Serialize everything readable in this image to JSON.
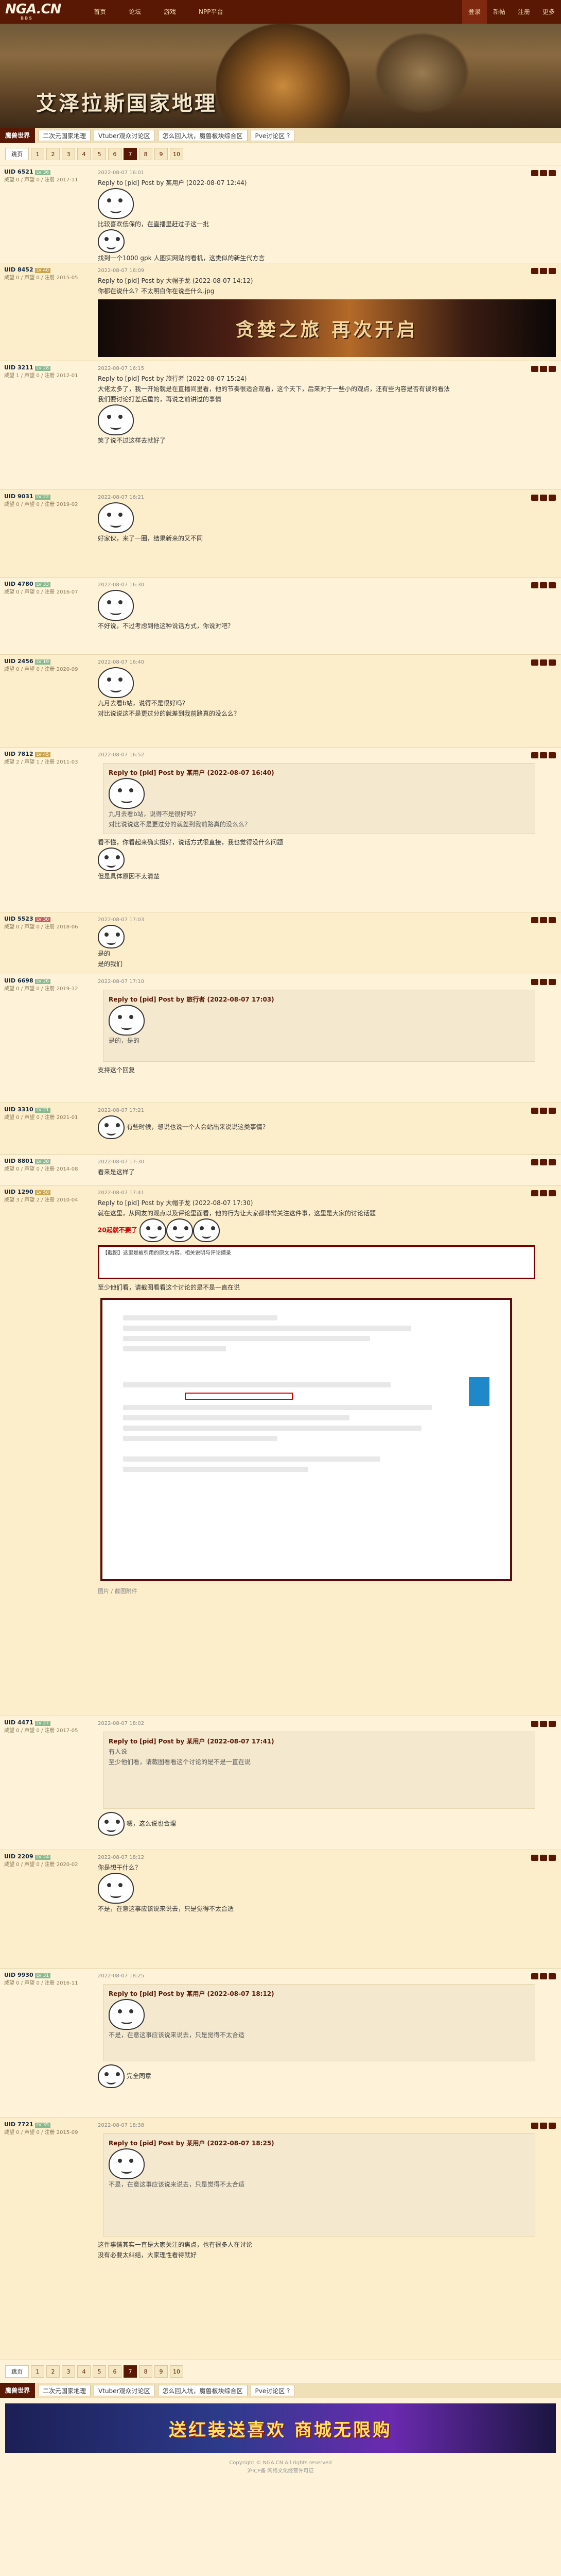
{
  "topnav": {
    "logo_big": "NGA.CN",
    "logo_small": "BBS",
    "items": [
      "首页",
      "论坛",
      "游戏",
      "NPP平台"
    ],
    "right": [
      "登录",
      "新帖",
      "注册",
      "更多"
    ]
  },
  "banner": {
    "title": "艾泽拉斯国家地理"
  },
  "forum_tabs": {
    "fid": "魔兽世界",
    "links": [
      "二次元国家地理",
      "Vtuber观众讨论区",
      "怎么回入坑，魔兽板块综合区",
      "Pve讨论区 ?"
    ]
  },
  "pager": {
    "label": "跳页",
    "pages": [
      "1",
      "2",
      "3",
      "4",
      "5",
      "6",
      "7",
      "8",
      "9",
      "10"
    ],
    "current": "7"
  },
  "posts": [
    {
      "user": "UID 6521",
      "lv": "LV 36",
      "meta": "威望 0 / 声望 0 / 注册 2017-11",
      "time": "2022-08-07 16:01",
      "quote": "Reply to [pid] Post by 某用户 (2022-08-07 12:44)",
      "text": "比较喜欢低保的，在直播里赶过子这一批",
      "text2": "找到一个1000 gpk 人图实网贴的看机，这类似的新生代方言"
    },
    {
      "user": "UID 8452",
      "lv": "LV 40",
      "meta": "威望 0 / 声望 0 / 注册 2015-05",
      "time": "2022-08-07 16:09",
      "quote": "Reply to [pid] Post by 大帽子龙 (2022-08-07 14:12)",
      "text": "你都在说什么？不太明白你在说些什么.jpg",
      "game_banner": "贪婪之旅 再次开启"
    },
    {
      "user": "UID 3211",
      "lv": "LV 28",
      "meta": "威望 1 / 声望 0 / 注册 2012-01",
      "time": "2022-08-07 16:15",
      "quote": "Reply to [pid] Post by 旅行者 (2022-08-07 15:24)",
      "text": "大佬太多了，我一开始就是在直播间里看，他的节奏很适合观看，这个天下，后来对于一些小的观点，还有些内容是否有误的看法",
      "text2": "我们要讨论打差后重的，再说之前讲过的事情",
      "text3": "笑了说不过这样去就好了"
    },
    {
      "user": "UID 9031",
      "lv": "LV 22",
      "meta": "威望 0 / 声望 0 / 注册 2019-02",
      "time": "2022-08-07 16:21",
      "text": "好家伙，来了一圈，结果新来的又不同"
    },
    {
      "user": "UID 4780",
      "lv": "LV 33",
      "meta": "威望 0 / 声望 0 / 注册 2016-07",
      "time": "2022-08-07 16:30",
      "text": "不好说，不过考虑到他这种说话方式，你说对吧？"
    },
    {
      "user": "UID 2456",
      "lv": "LV 19",
      "meta": "威望 0 / 声望 0 / 注册 2020-09",
      "time": "2022-08-07 16:40",
      "text": "九月去看b站，说得不是很好吗？",
      "text2": "对比说说这不是更过分的就差到我前路真的没么么？"
    },
    {
      "user": "UID 7812",
      "lv": "LV 45",
      "meta": "威望 2 / 声望 1 / 注册 2011-03",
      "time": "2022-08-07 16:52",
      "quote": "Reply to [pid] Post by 某用户 (2022-08-07 16:40)",
      "qtext": "九月去看b站，说得不是很好吗？",
      "qtext2": "对比说说这不是更过分的就差到我前路真的没么么？",
      "text": "看不懂，你看起来确实挺好，说话方式很直接，我也觉得没什么问题",
      "text2": "但是具体原因不太清楚"
    },
    {
      "user": "UID 5523",
      "lv": "LV 30",
      "meta": "威望 0 / 声望 0 / 注册 2018-06",
      "time": "2022-08-07 17:03",
      "text": "是的",
      "text2": "是的我们"
    },
    {
      "user": "UID 6698",
      "lv": "LV 26",
      "meta": "威望 0 / 声望 0 / 注册 2019-12",
      "time": "2022-08-07 17:10",
      "quote": "Reply to [pid] Post by 旅行者 (2022-08-07 17:03)",
      "qtext": "是的，是的",
      "text": "支持这个回复"
    },
    {
      "user": "UID 3310",
      "lv": "LV 21",
      "meta": "威望 0 / 声望 0 / 注册 2021-01",
      "time": "2022-08-07 17:21",
      "text": "有些时候，想说也说一个人会站出来说说这类事情？"
    },
    {
      "user": "UID 8801",
      "lv": "LV 38",
      "meta": "威望 0 / 声望 0 / 注册 2014-08",
      "time": "2022-08-07 17:30",
      "text": "看来是这样了"
    },
    {
      "user": "UID 1290",
      "lv": "LV 50",
      "meta": "威望 3 / 声望 2 / 注册 2010-04",
      "time": "2022-08-07 17:41",
      "quote": "Reply to [pid] Post by 大帽子龙 (2022-08-07 17:30)",
      "text": "就在这里，从网友的观点以及评论里面看，他的行为让大家都非常关注这件事，这里是大家的讨论话题",
      "red": "20起就不要了",
      "box": "【截图】这里是被引用的原文内容，相关说明与评论摘录",
      "text2": "至少他们看，请截图看看这个讨论的是不是一直在说",
      "tags": "图片 / 截图附件"
    },
    {
      "user": "UID 4471",
      "lv": "LV 27",
      "meta": "威望 0 / 声望 0 / 注册 2017-05",
      "time": "2022-08-07 18:02",
      "quote": "Reply to [pid] Post by 某用户 (2022-08-07 17:41)",
      "qtext": "有人说",
      "qtext2": "至少他们看，请截图看看这个讨论的是不是一直在说",
      "text": "嗯，这么说也合理"
    },
    {
      "user": "UID 2209",
      "lv": "LV 24",
      "meta": "威望 0 / 声望 0 / 注册 2020-02",
      "time": "2022-08-07 18:12",
      "text": "你是想干什么？",
      "text2": "不是，在意这事应该说来说去，只是觉得不太合适"
    },
    {
      "user": "UID 9930",
      "lv": "LV 31",
      "meta": "威望 0 / 声望 0 / 注册 2016-11",
      "time": "2022-08-07 18:25",
      "quote": "Reply to [pid] Post by 某用户 (2022-08-07 18:12)",
      "qtext": "不是，在意这事应该说来说去，只是觉得不太合适",
      "text": "完全同意"
    },
    {
      "user": "UID 7721",
      "lv": "LV 35",
      "meta": "威望 0 / 声望 0 / 注册 2015-09",
      "time": "2022-08-07 18:38",
      "quote": "Reply to [pid] Post by 某用户 (2022-08-07 18:25)",
      "qtext": "不是，在意这事应该说来说去，只是觉得不太合适",
      "text": "这件事情其实一直是大家关注的焦点，也有很多人在讨论",
      "text2": "没有必要太纠结，大家理性看待就好"
    }
  ],
  "bottom_pager": {
    "label": "跳页",
    "pages": [
      "1",
      "2",
      "3",
      "4",
      "5",
      "6",
      "7",
      "8",
      "9",
      "10"
    ],
    "current": "7"
  },
  "ad": {
    "text": "送红装送喜欢 商城无限购"
  },
  "footer": {
    "line1": "Copyright © NGA.CN All rights reserved",
    "line2": "沪ICP备 网络文化经营许可证"
  }
}
